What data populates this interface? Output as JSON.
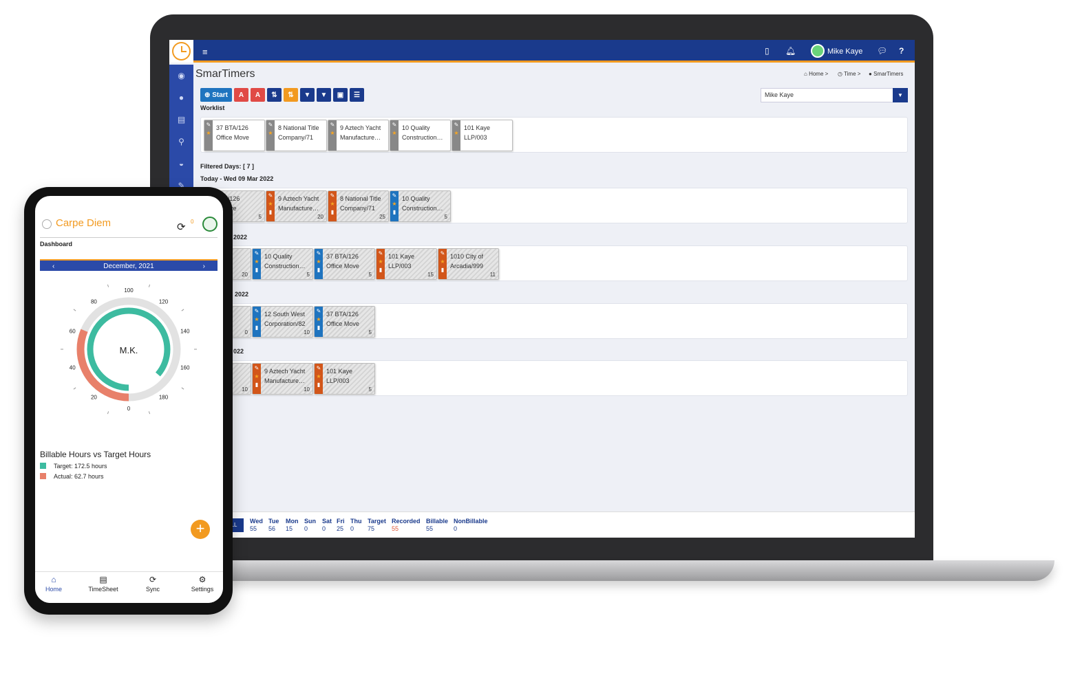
{
  "desktop": {
    "user": "Mike Kaye",
    "page_title": "SmarTimers",
    "breadcrumb": [
      "Home >",
      "Time >",
      "SmarTimers"
    ],
    "toolbar": {
      "start_label": "Start"
    },
    "user_select": "Mike Kaye",
    "worklist_label": "Worklist",
    "worklist": [
      {
        "title": "37 BTA/126",
        "sub": "Office Move"
      },
      {
        "title": "8 National Title",
        "sub": "Company/71"
      },
      {
        "title": "9 Aztech Yacht",
        "sub": "Manufacture…"
      },
      {
        "title": "10 Quality",
        "sub": "Construction…"
      },
      {
        "title": "101 Kaye",
        "sub": "LLP/003"
      }
    ],
    "filtered_days": "Filtered Days: [ 7 ]",
    "day_labels": [
      "Today - Wed 09 Mar 2022",
      "2022",
      "2022",
      "022"
    ],
    "days": [
      [
        {
          "title": "BTA/126",
          "sub": "e Move",
          "num": "5"
        },
        {
          "title": "9 Aztech Yacht",
          "sub": "Manufacture…",
          "num": "20"
        },
        {
          "title": "8 National Title",
          "sub": "Company/71",
          "num": "25"
        },
        {
          "title": "10 Quality",
          "sub": "Construction…",
          "num": "5"
        }
      ],
      [
        {
          "title": "aye",
          "sub": "03",
          "num": "20"
        },
        {
          "title": "10 Quality",
          "sub": "Construction…",
          "num": "5"
        },
        {
          "title": "37 BTA/126",
          "sub": "Office Move",
          "num": "5"
        },
        {
          "title": "101 Kaye",
          "sub": "LLP/003",
          "num": "15"
        },
        {
          "title": "1010 City of",
          "sub": "Arcadia/999",
          "num": "11"
        }
      ],
      [
        {
          "title": "aye",
          "sub": "03",
          "num": "0"
        },
        {
          "title": "12 South West",
          "sub": "Corporation/82",
          "num": "10"
        },
        {
          "title": "37 BTA/126",
          "sub": "Office Move",
          "num": "5"
        }
      ],
      [
        {
          "title": "/126",
          "sub": "Move",
          "num": "10"
        },
        {
          "title": "9 Aztech Yacht",
          "sub": "Manufacture…",
          "num": "10"
        },
        {
          "title": "101 Kaye",
          "sub": "LLP/003",
          "num": "5"
        }
      ]
    ],
    "stats_all": "LL",
    "stats": [
      {
        "label": "Wed",
        "value": "55"
      },
      {
        "label": "Tue",
        "value": "56"
      },
      {
        "label": "Mon",
        "value": "15"
      },
      {
        "label": "Sun",
        "value": "0"
      },
      {
        "label": "Sat",
        "value": "0"
      },
      {
        "label": "Fri",
        "value": "25"
      },
      {
        "label": "Thu",
        "value": "0"
      },
      {
        "label": "Target",
        "value": "75"
      },
      {
        "label": "Recorded",
        "value": "55"
      },
      {
        "label": "Billable",
        "value": "55"
      },
      {
        "label": "NonBillable",
        "value": "0"
      }
    ],
    "colors": {
      "navy": "#1a3a8c",
      "orange": "#f29a20",
      "job_orange": "#d2561a",
      "job_blue": "#1f74bf",
      "recorded": "#e05a3a"
    }
  },
  "mobile": {
    "app_title": "Carpe Diem",
    "sync_badge": "0",
    "section": "Dashboard",
    "month": "December, 2021",
    "initials": "M.K.",
    "gauge": {
      "ticks": [
        "0",
        "20",
        "40",
        "60",
        "80",
        "100",
        "120",
        "140",
        "160",
        "180"
      ],
      "target_hours": 172.5,
      "actual_hours": 62.7
    },
    "legend_title": "Billable Hours vs Target Hours",
    "legend": [
      {
        "label": "Target: 172.5 hours",
        "color": "#3dbba0"
      },
      {
        "label": "Actual: 62.7 hours",
        "color": "#e8806a"
      }
    ],
    "nav": [
      "Home",
      "TimeSheet",
      "Sync",
      "Settings"
    ]
  }
}
